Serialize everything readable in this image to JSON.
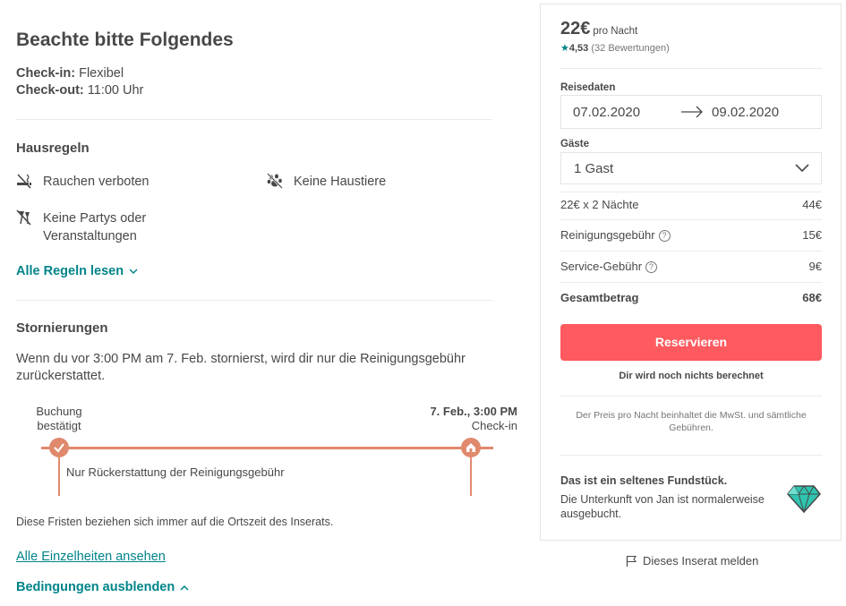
{
  "rules_section": {
    "title": "Beachte bitte Folgendes",
    "checkin_label": "Check-in:",
    "checkin_value": " Flexibel",
    "checkout_label": "Check-out:",
    "checkout_value": " 11:00 Uhr",
    "house_rules_title": "Hausregeln",
    "rules": [
      {
        "icon": "no-smoking-icon",
        "label": "Rauchen verboten"
      },
      {
        "icon": "no-pets-icon",
        "label": "Keine Haustiere"
      },
      {
        "icon": "no-parties-icon",
        "label": "Keine Partys oder Veranstaltungen"
      }
    ],
    "read_all_rules": "Alle Regeln lesen"
  },
  "cancellation": {
    "title": "Stornierungen",
    "text": "Wenn du vor 3:00 PM am 7. Feb. stornierst, wird dir nur die Reinigungsgebühr zurückerstattet.",
    "timeline": {
      "start_label_1": "Buchung",
      "start_label_2": "bestätigt",
      "end_label_1": "7. Feb., 3:00 PM",
      "end_label_2": "Check-in",
      "segment_label": "Nur Rückerstattung der Reinigungsgebühr"
    },
    "note": "Diese Fristen beziehen sich immer auf die Ortszeit des Inserats.",
    "details_link": "Alle Einzelheiten ansehen",
    "hide_link": "Bedingungen ausblenden"
  },
  "booking": {
    "price": "22€",
    "per_night": "pro Nacht",
    "star": "★",
    "rating": "4,53",
    "reviews": "(32 Bewertungen)",
    "dates_label": "Reisedaten",
    "checkin_date": "07.02.2020",
    "checkout_date": "09.02.2020",
    "guests_label": "Gäste",
    "guests_value": "1 Gast",
    "lines": [
      {
        "label": "22€ x 2 Nächte",
        "value": "44€",
        "info": false
      },
      {
        "label": "Reinigungsgebühr",
        "value": "15€",
        "info": true
      },
      {
        "label": "Service-Gebühr",
        "value": "9€",
        "info": true
      }
    ],
    "total_label": "Gesamtbetrag",
    "total_value": "68€",
    "reserve_button": "Reservieren",
    "no_charge": "Dir wird noch nichts berechnet",
    "tax_note": "Der Preis pro Nacht beinhaltet die MwSt. und sämtliche Gebühren.",
    "rare_title": "Das ist ein seltenes Fundstück.",
    "rare_text": "Die Unterkunft von Jan ist normalerweise ausgebucht."
  },
  "report_link": "Dieses Inserat melden",
  "colors": {
    "accent_teal": "#008489",
    "reserve_red": "#ff5a5f",
    "timeline_orange": "#e0896d"
  }
}
